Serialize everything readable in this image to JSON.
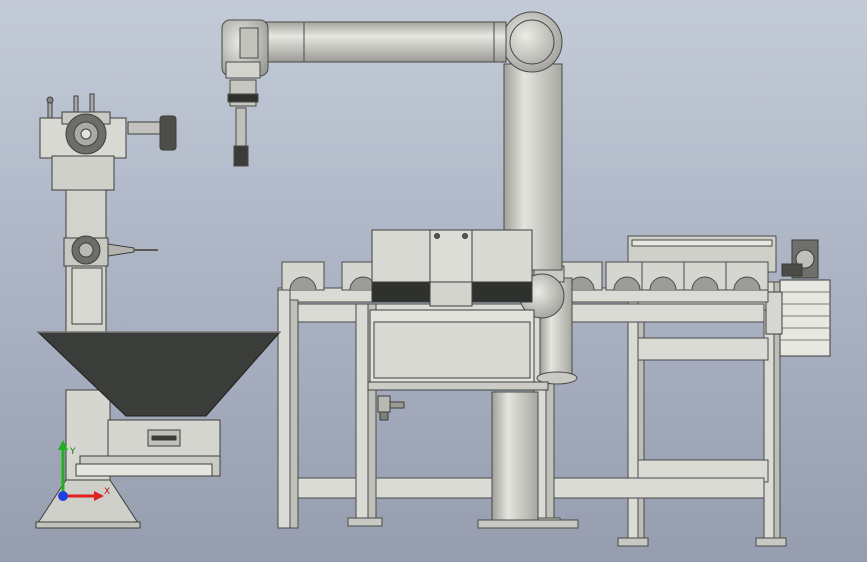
{
  "scene": {
    "description_visible_text": "",
    "triad": {
      "x_label": "X",
      "y_label": "Y"
    },
    "colors": {
      "metal": "#d2d3cc",
      "metal_dark": "#b8b9b2",
      "frame": "#dadbd4",
      "hopper": "#3b3d3a",
      "band": "#2f312e",
      "outline": "#4a4b48",
      "axis_x": "#e02020",
      "axis_y": "#20b020",
      "axis_z": "#2040e0"
    }
  }
}
